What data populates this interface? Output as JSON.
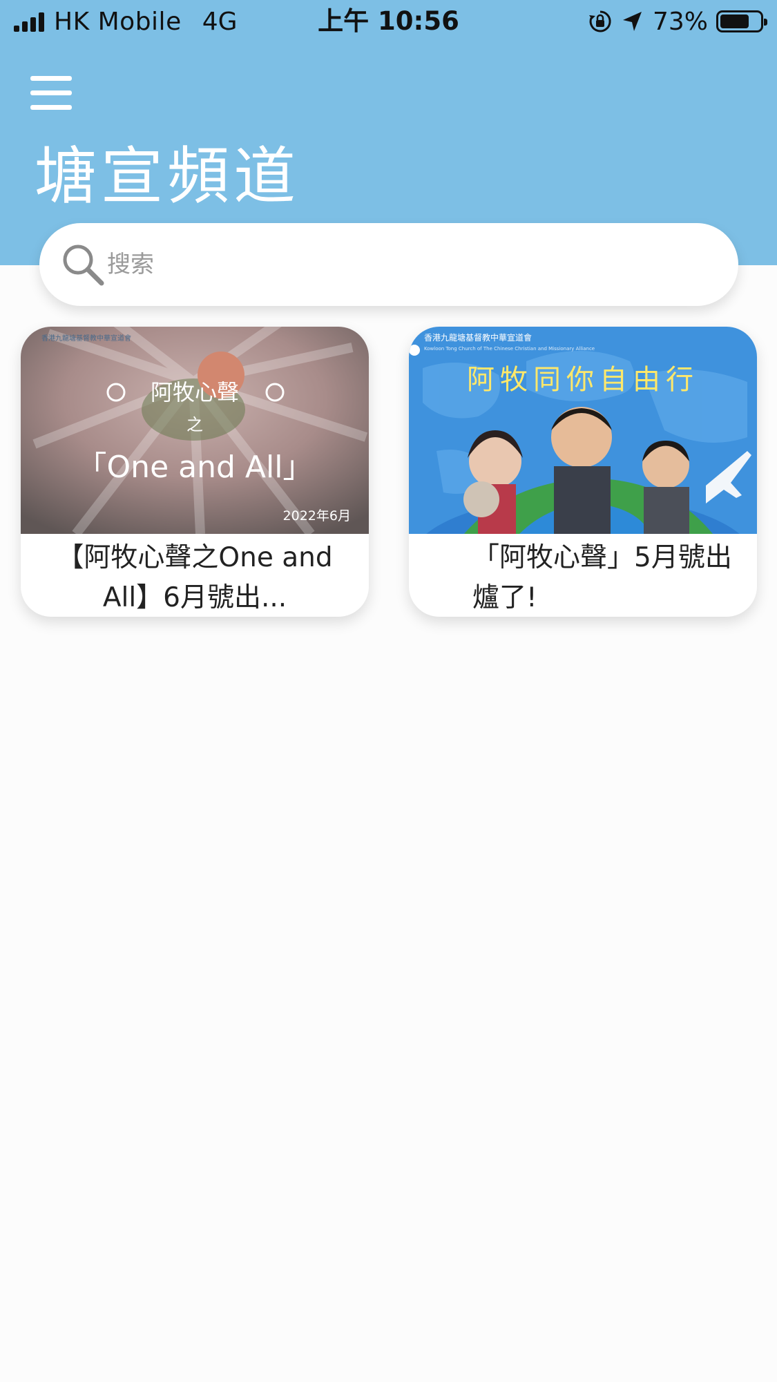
{
  "status_bar": {
    "carrier": "HK Mobile",
    "network": "4G",
    "time": "上午 10:56",
    "battery": "73%",
    "battery_level": 0.73
  },
  "header": {
    "title": "塘宣頻道",
    "menu_icon": "hamburger-menu-icon"
  },
  "search": {
    "placeholder": "搜索",
    "value": "",
    "icon": "search-icon"
  },
  "cards": [
    {
      "title": "【阿牧心聲之One and All】6月號出...",
      "thumb": {
        "org": "香港九龍塘基督教中華宣道會",
        "line1": "阿牧心聲",
        "line2": "之",
        "line3": "「One and All」",
        "date": "2022年6月"
      }
    },
    {
      "title": "「阿牧心聲」5月號出爐了!",
      "thumb": {
        "org": "香港九龍塘基督教中華宣道會",
        "org_en": "Kowloon Tong Church of The Chinese Christian and Missionary Alliance",
        "headline": "阿牧同你自由行"
      }
    }
  ],
  "colors": {
    "header_bg": "#7dbfe5",
    "page_bg": "#fcfcfc"
  }
}
